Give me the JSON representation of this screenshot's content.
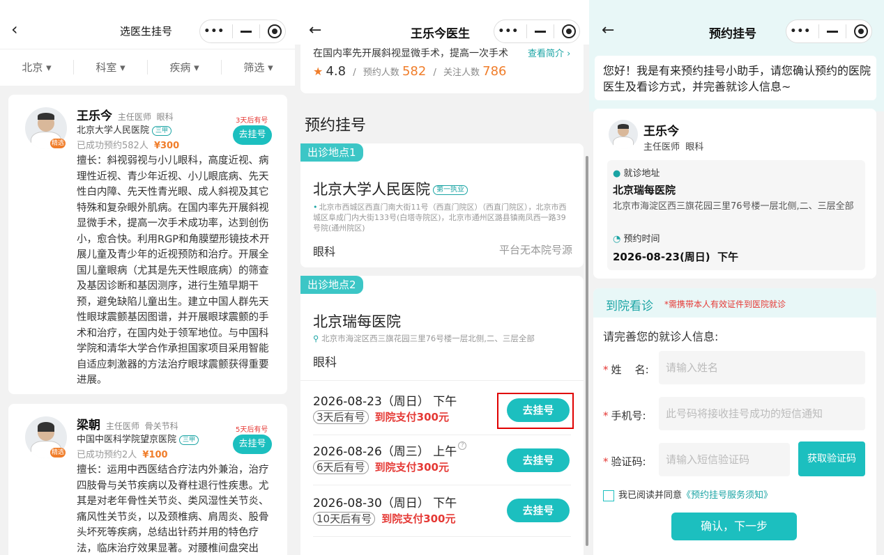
{
  "panel1": {
    "title": "选医生挂号",
    "back_icon": "‹",
    "filters": [
      "北京",
      "科室",
      "疾病",
      "筛选"
    ],
    "doctors": [
      {
        "name": "王乐今",
        "title": "主任医师",
        "dept": "眼科",
        "hospital": "北京大学人民医院",
        "level": "三甲",
        "booked": "已成功预约582人",
        "price": "¥300",
        "badge": "精选",
        "avail": "3天后有号",
        "btn": "去挂号",
        "desc": "擅长：斜视弱视与小儿眼科，高度近视、病理性近视、青少年近视、小儿眼底病、先天性白内障、先天性青光眼、成人斜视及其它特殊和复杂眼外肌病。在国内率先开展斜视显微手术，提高一次手术成功率，达到创伤小，愈合快。利用RGP和角膜塑形镜技术开展儿童及青少年的近视预防和治疗。开展全国儿童眼病（尤其是先天性眼底病）的筛查及基因诊断和基因测序，进行生殖早期干预，避免缺陷儿童出生。建立中国人群先天性眼球震颤基因图谱，并开展眼球震颤的手术和治疗，在国内处于领军地位。与中国科学院和清华大学合作承担国家项目采用智能自适应刺激器的方法治疗眼球震颤获得重要进展。"
      },
      {
        "name": "梁朝",
        "title": "主任医师",
        "dept": "骨关节科",
        "hospital": "中国中医科学院望京医院",
        "level": "三甲",
        "booked": "已成功预约2人",
        "price": "¥100",
        "badge": "精选",
        "avail": "5天后有号",
        "btn": "去挂号",
        "desc": "擅长：运用中西医结合疗法内外兼治，治疗四肢骨与关节疾病以及脊柱退行性疾患。尤其是对老年骨性关节炎、类风湿性关节炎、痛风性关节炎，以及颈椎病、肩周炎、股骨头坏死等疾病，总结出针药并用的特色疗法，临床治疗效果显著。对腰椎间盘突出"
      }
    ]
  },
  "panel2": {
    "title": "王乐今医生",
    "intro_tail": "在国内率先开展斜视显微手术，提高一次手术",
    "see_more": "查看简介 ›",
    "rating": "4.8",
    "booked_label": "预约人数",
    "booked_count": "582",
    "follow_label": "关注人数",
    "follow_count": "786",
    "section_title": "预约挂号",
    "locations": [
      {
        "tag": "出诊地点1",
        "hospital": "北京大学人民医院",
        "hospital_tag": "第一执业",
        "address": "北京市西城区西直门南大街11号（西直门院区）（西直门院区），北京市西城区阜成门内大街133号(白塔寺院区)，北京市通州区潞县镇南凤西一路39号院(通州院区)",
        "dept": "眼科",
        "note": "平台无本院号源"
      },
      {
        "tag": "出诊地点2",
        "hospital": "北京瑞每医院",
        "address": "北京市海淀区西三旗花园三里76号楼一层北侧,二、三层全部",
        "dept": "眼科"
      }
    ],
    "slots": [
      {
        "date": "2026-08-23（周日） 下午",
        "avail": "3天后有号",
        "pay": "到院支付300元",
        "btn": "去挂号"
      },
      {
        "date": "2026-08-26（周三） 上午",
        "avail": "6天后有号",
        "pay": "到院支付300元",
        "btn": "去挂号"
      },
      {
        "date": "2026-08-30（周日） 下午",
        "avail": "10天后有号",
        "pay": "到院支付300元",
        "btn": "去挂号"
      }
    ]
  },
  "panel3": {
    "title": "预约挂号",
    "greeting": "您好！我是有来预约挂号小助手，请您确认预约的医院医生及看诊方式，并完善就诊人信息~",
    "doctor_name": "王乐今",
    "doctor_title": "主任医师  眼科",
    "addr_label": "就诊地址",
    "addr_hospital": "北京瑞每医院",
    "addr_text": "北京市海淀区西三旗花园三里76号楼一层北侧,二、三层全部",
    "time_label": "预约时间",
    "time_value": "2026-08-23(周日)  下午",
    "visit_type": "到院看诊",
    "visit_note": "*需携带本人有效证件到医院就诊",
    "form_title": "请完善您的就诊人信息:",
    "name_label": "姓    名:",
    "name_placeholder": "请输入姓名",
    "phone_label": "手机号:",
    "phone_placeholder": "此号码将接收挂号成功的短信通知",
    "code_label": "验证码:",
    "code_placeholder": "请输入短信验证码",
    "get_code": "获取验证码",
    "agree_prefix": "我已阅读并同意",
    "agree_link": "《预约挂号服务须知》",
    "confirm": "确认，下一步"
  },
  "colors": {
    "accent": "#1cbfbf",
    "price": "#f07d2a",
    "pay": "#e53935",
    "highlight_box": "#e00000"
  }
}
